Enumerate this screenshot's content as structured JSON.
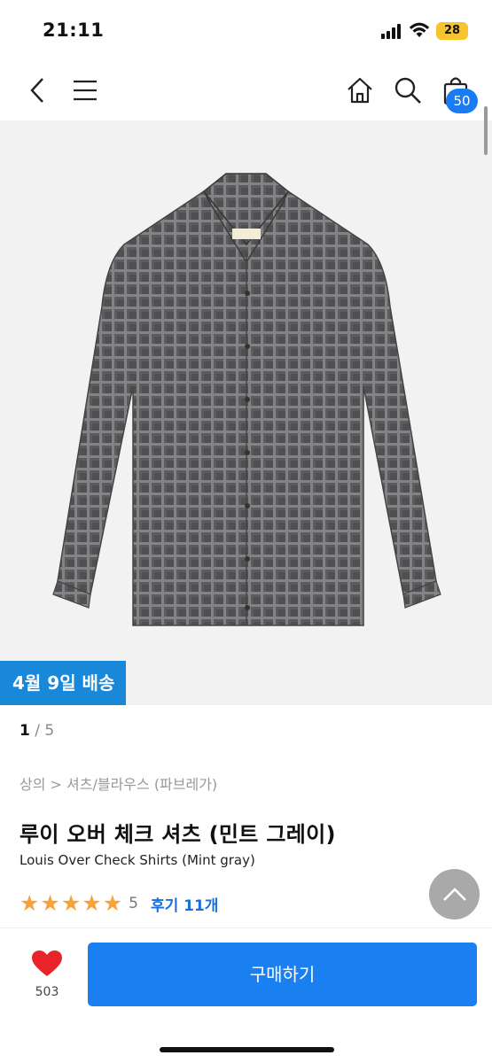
{
  "status_bar": {
    "time": "21:11",
    "battery": "28",
    "battery_color": "#f6c42e"
  },
  "nav": {
    "icons": [
      "back-icon",
      "menu-icon",
      "home-icon",
      "search-icon",
      "cart-icon"
    ],
    "cart_count": "50",
    "accent": "#1a7cf5"
  },
  "gallery": {
    "delivery_tag": "4월 9일 배송",
    "current_page": "1",
    "page_separator": " / ",
    "total_pages": "5"
  },
  "product": {
    "breadcrumb": "상의 > 셔츠/블라우스 (파브레가)",
    "title": "루이 오버 체크 셔츠 (민트 그레이)",
    "subtitle": "Louis Over Check Shirts (Mint gray)",
    "stars": 5,
    "rating_score": "5",
    "review_link": "후기 11개",
    "star_color": "#f6a33b"
  },
  "bottom_bar": {
    "like_count": "503",
    "buy_label": "구매하기",
    "buy_color": "#1a80f2",
    "heart_color": "#e8232a"
  },
  "icons": {
    "scroll_top": "chevron-up-icon"
  }
}
